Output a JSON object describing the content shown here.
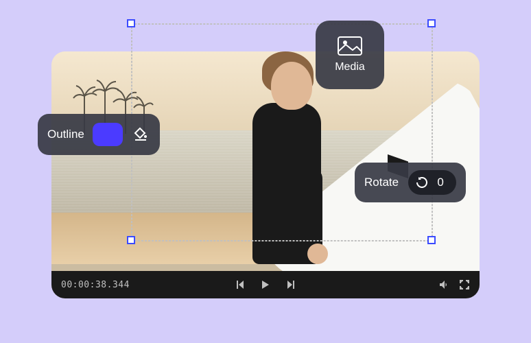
{
  "outline": {
    "label": "Outline",
    "swatch_color": "#4b3bff"
  },
  "media": {
    "label": "Media"
  },
  "rotate": {
    "label": "Rotate",
    "value": "0"
  },
  "playback": {
    "timecode": "00:00:38.344"
  }
}
